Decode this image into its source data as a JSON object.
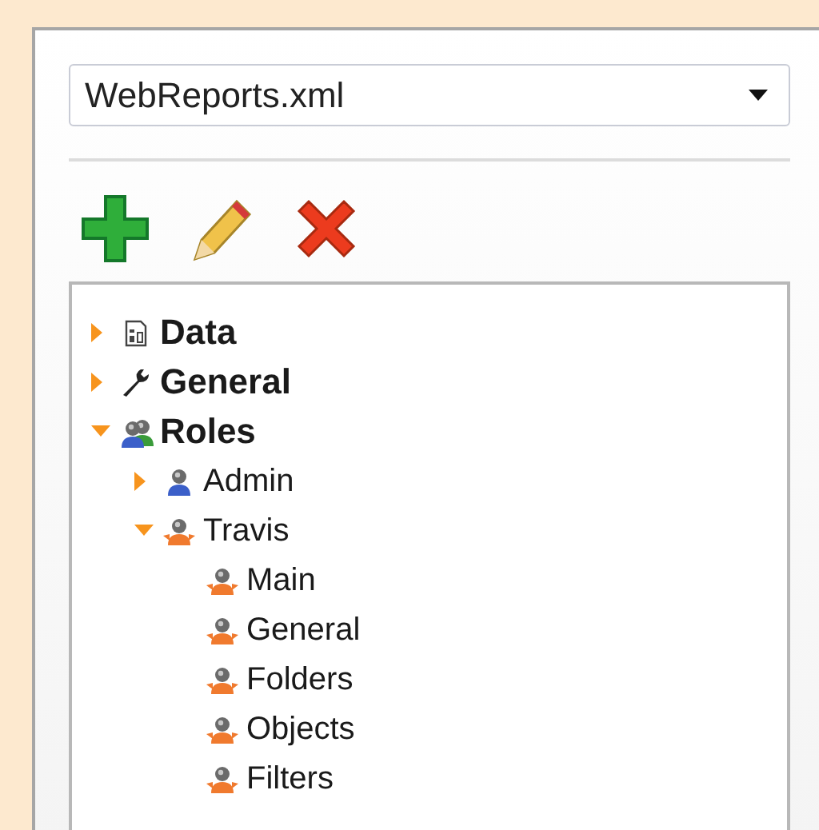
{
  "file_select": {
    "value": "WebReports.xml"
  },
  "toolbar": [
    {
      "kind": "add"
    },
    {
      "kind": "edit"
    },
    {
      "kind": "delete"
    }
  ],
  "tree": [
    {
      "label": "Data",
      "kind": "data",
      "expanded": false
    },
    {
      "label": "General",
      "kind": "tool",
      "expanded": false
    },
    {
      "label": "Roles",
      "kind": "group",
      "expanded": true,
      "children": [
        {
          "label": "Admin",
          "kind": "admin",
          "expanded": false
        },
        {
          "label": "Travis",
          "kind": "user",
          "expanded": true,
          "children": [
            {
              "label": "Main",
              "kind": "user"
            },
            {
              "label": "General",
              "kind": "user"
            },
            {
              "label": "Folders",
              "kind": "user"
            },
            {
              "label": "Objects",
              "kind": "user"
            },
            {
              "label": "Filters",
              "kind": "user"
            }
          ]
        }
      ]
    }
  ]
}
